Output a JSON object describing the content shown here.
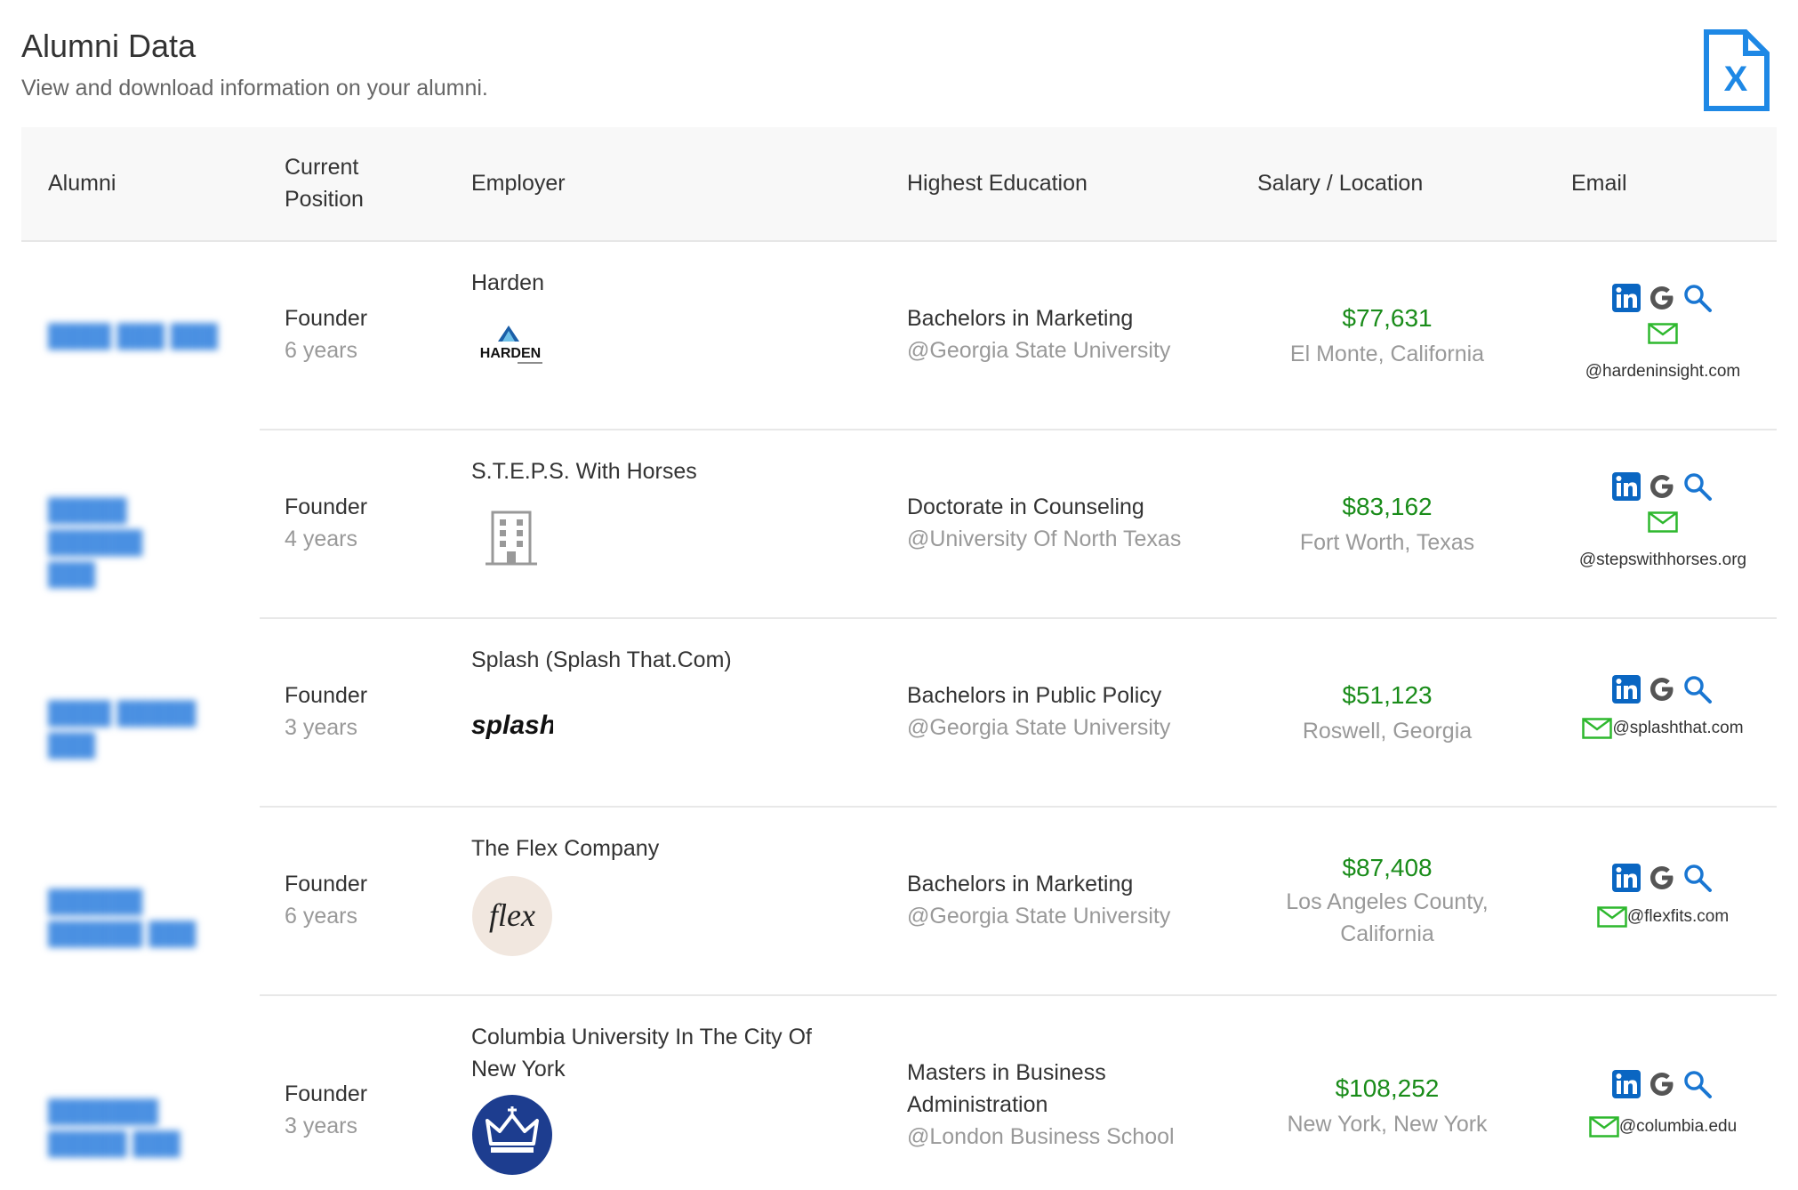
{
  "header": {
    "title": "Alumni Data",
    "subtitle": "View and download information on your alumni.",
    "export_icon": "excel-file-icon"
  },
  "table": {
    "columns": {
      "alumni": "Alumni",
      "position_line1": "Current",
      "position_line2": "Position",
      "employer": "Employer",
      "education": "Highest Education",
      "salary_location": "Salary / Location",
      "email": "Email"
    },
    "rows": [
      {
        "position": "Founder",
        "years": "6 years",
        "employer": "Harden",
        "logo": "harden-logo",
        "degree": "Bachelors in Marketing",
        "school": "@Georgia State University",
        "salary": "$77,631",
        "location": "El Monte, California",
        "email_domain": "@hardeninsight.com"
      },
      {
        "position": "Founder",
        "years": "4 years",
        "employer": "S.T.E.P.S. With Horses",
        "logo": "building-icon",
        "degree": "Doctorate in Counseling",
        "school": "@University Of North Texas",
        "salary": "$83,162",
        "location": "Fort Worth, Texas",
        "email_domain": "@stepswithhorses.org"
      },
      {
        "position": "Founder",
        "years": "3 years",
        "employer": "Splash (Splash That.Com)",
        "logo": "splash-logo",
        "degree": "Bachelors in Public Policy",
        "school": "@Georgia State University",
        "salary": "$51,123",
        "location": "Roswell, Georgia",
        "email_domain": "@splashthat.com"
      },
      {
        "position": "Founder",
        "years": "6 years",
        "employer": "The Flex Company",
        "logo": "flex-logo",
        "degree": "Bachelors in Marketing",
        "school": "@Georgia State University",
        "salary": "$87,408",
        "location_line1": "Los Angeles County,",
        "location_line2": "California",
        "email_domain": "@flexfits.com"
      },
      {
        "position": "Founder",
        "years": "3 years",
        "employer_line1": "Columbia University In The City Of",
        "employer_line2": "New York",
        "logo": "columbia-crown-logo",
        "degree_line1": "Masters in Business",
        "degree_line2": "Administration",
        "school": "@London Business School",
        "salary": "$108,252",
        "location": "New York, New York",
        "email_domain": "@columbia.edu"
      }
    ]
  },
  "logos": {
    "harden_text": "HARDEN",
    "splash_text": "splash",
    "flex_text": "flex"
  },
  "colors": {
    "salary_green": "#1a8c1a",
    "linkedin_blue": "#0a66c2",
    "search_blue": "#1976d2",
    "mail_green": "#2eb82e",
    "excel_blue": "#1e88e5"
  }
}
